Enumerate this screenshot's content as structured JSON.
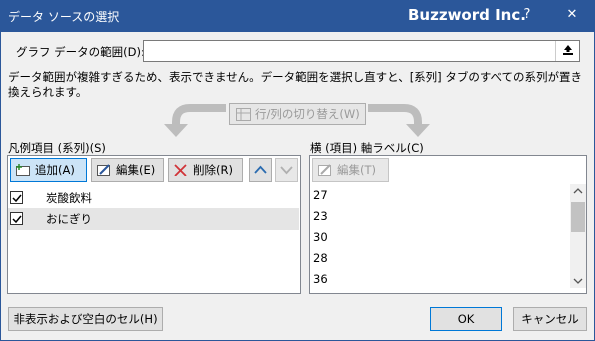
{
  "window": {
    "title": "データ ソースの選択",
    "brand": "Buzzword Inc.",
    "help_glyph": "?",
    "close_glyph": "✕"
  },
  "range": {
    "label": "グラフ データの範囲(D):",
    "value": "",
    "message": "データ範囲が複雑すぎるため、表示できません。データ範囲を選択し直すと、[系列] タブのすべての系列が置き換えられます。"
  },
  "switch_button": {
    "label": "行/列の切り替え(W)"
  },
  "legend": {
    "label": "凡例項目 (系列)(S)",
    "add_label": "追加(A)",
    "edit_label": "編集(E)",
    "delete_label": "削除(R)",
    "series": [
      {
        "name": "炭酸飲料",
        "checked": true,
        "selected": false
      },
      {
        "name": "おにぎり",
        "checked": true,
        "selected": true
      }
    ]
  },
  "axis": {
    "label": "横 (項目) 軸ラベル(C)",
    "edit_label": "編集(T)",
    "items": [
      "27",
      "23",
      "30",
      "28",
      "36"
    ]
  },
  "buttons": {
    "hidden_cells": "非表示および空白のセル(H)",
    "ok": "OK",
    "cancel": "キャンセル"
  }
}
